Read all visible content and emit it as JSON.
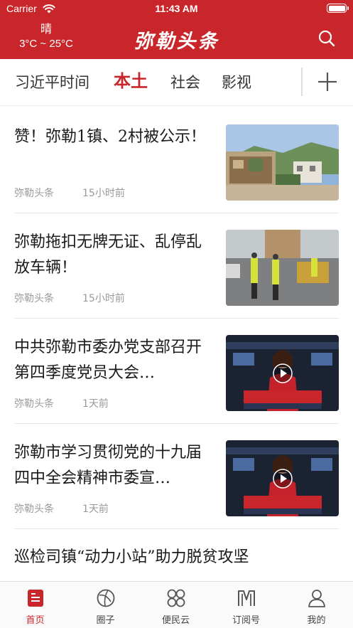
{
  "status_bar": {
    "carrier": "Carrier",
    "time": "11:43 AM"
  },
  "header": {
    "weather_condition": "晴",
    "weather_temp": "3°C ~ 25°C",
    "title": "弥勒头条",
    "accent_color": "#c8262a"
  },
  "tabs": [
    {
      "label": "习近平时间",
      "active": false
    },
    {
      "label": "本土",
      "active": true
    },
    {
      "label": "社会",
      "active": false
    },
    {
      "label": "影视",
      "active": false
    }
  ],
  "news": [
    {
      "title": "赞！弥勒1镇、2村被公示！",
      "source": "弥勒头条",
      "time": "15小时前",
      "thumb": "village-mural-photo",
      "video": false
    },
    {
      "title": "弥勒拖扣无牌无证、乱停乱放车辆！",
      "source": "弥勒头条",
      "time": "15小时前",
      "thumb": "traffic-police-photo",
      "video": false
    },
    {
      "title": "中共弥勒市委办党支部召开第四季度党员大会…",
      "source": "弥勒头条",
      "time": "1天前",
      "thumb": "news-anchor-video",
      "video": true
    },
    {
      "title": "弥勒市学习贯彻党的十九届四中全会精神市委宣…",
      "source": "弥勒头条",
      "time": "1天前",
      "thumb": "news-anchor-video",
      "video": true
    }
  ],
  "partial_news": {
    "title": "巡检司镇“动力小站”助力脱贫攻坚"
  },
  "tabbar": [
    {
      "label": "首页",
      "icon": "home-icon",
      "active": true
    },
    {
      "label": "圈子",
      "icon": "circle-icon",
      "active": false
    },
    {
      "label": "便民云",
      "icon": "services-icon",
      "active": false
    },
    {
      "label": "订阅号",
      "icon": "subscription-icon",
      "active": false
    },
    {
      "label": "我的",
      "icon": "profile-icon",
      "active": false
    }
  ]
}
